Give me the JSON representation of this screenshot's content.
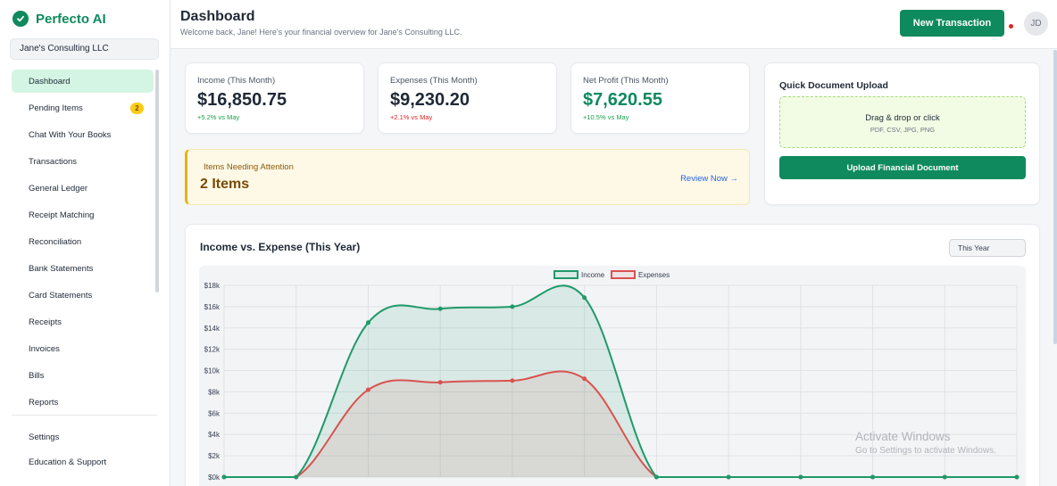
{
  "brand": {
    "name": "Perfecto AI"
  },
  "company": {
    "name": "Jane's Consulting LLC"
  },
  "sidebar": {
    "items": [
      {
        "label": "Dashboard"
      },
      {
        "label": "Pending Items",
        "badge": "2"
      },
      {
        "label": "Chat With Your Books"
      },
      {
        "label": "Transactions"
      },
      {
        "label": "General Ledger"
      },
      {
        "label": "Receipt Matching"
      },
      {
        "label": "Reconciliation"
      },
      {
        "label": "Bank Statements"
      },
      {
        "label": "Card Statements"
      },
      {
        "label": "Receipts"
      },
      {
        "label": "Invoices"
      },
      {
        "label": "Bills"
      },
      {
        "label": "Reports"
      }
    ],
    "bottom": [
      {
        "label": "Settings"
      },
      {
        "label": "Education & Support"
      }
    ]
  },
  "header": {
    "title": "Dashboard",
    "subtitle": "Welcome back, Jane! Here's your financial overview for Jane's Consulting LLC.",
    "new_button": "New Transaction",
    "avatar": "JD"
  },
  "kpis": [
    {
      "label": "Income (This Month)",
      "value": "$16,850.75",
      "delta": "+5.2% vs May"
    },
    {
      "label": "Expenses (This Month)",
      "value": "$9,230.20",
      "delta": "+2.1% vs May"
    },
    {
      "label": "Net Profit (This Month)",
      "value": "$7,620.55",
      "delta": "+10.5% vs May"
    }
  ],
  "attention": {
    "label": "Items Needing Attention",
    "count": "2 Items",
    "link": "Review Now →"
  },
  "upload": {
    "title": "Quick Document Upload",
    "drop_text": "Drag & drop or click",
    "formats": "PDF, CSV, JPG, PNG",
    "button": "Upload Financial Document"
  },
  "chart": {
    "title": "Income vs. Expense (This Year)",
    "period": "This Year"
  },
  "colors": {
    "accent": "#0f8a5f",
    "income": "#1f9a6a",
    "expenses": "#d9534f"
  },
  "chart_data": {
    "type": "line",
    "title": "",
    "y_ticks": [
      "$0k",
      "$2k",
      "$4k",
      "$6k",
      "$8k",
      "$10k",
      "$12k",
      "$14k",
      "$16k",
      "$18k"
    ],
    "ylim": [
      0,
      18000
    ],
    "point_count": 12,
    "series": [
      {
        "name": "Income",
        "values": [
          0,
          0,
          14500,
          15800,
          16000,
          16850.75,
          0,
          0,
          0,
          0,
          0,
          0
        ]
      },
      {
        "name": "Expenses",
        "values": [
          0,
          0,
          8200,
          8900,
          9050,
          9230.2,
          0,
          0,
          0,
          0,
          0,
          0
        ]
      }
    ],
    "legend": "top-center",
    "grid": true
  },
  "watermark": {
    "line1": "Activate Windows",
    "line2": "Go to Settings to activate Windows."
  }
}
